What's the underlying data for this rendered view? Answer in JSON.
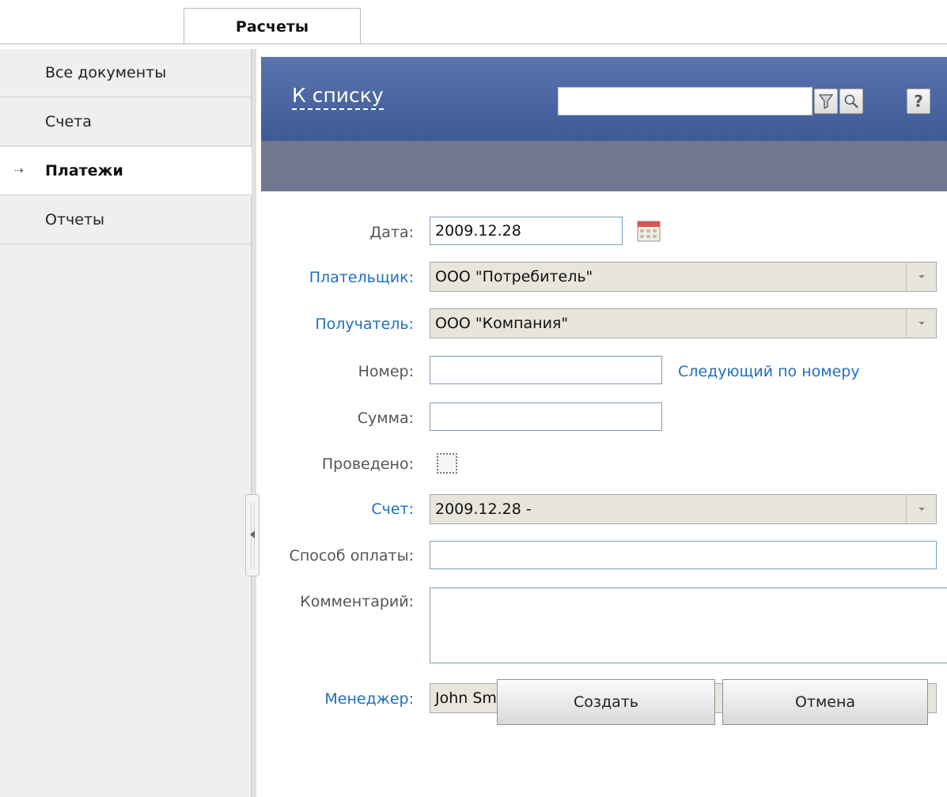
{
  "tabs": [
    {
      "label": "Расчеты"
    }
  ],
  "sidebar": {
    "items": [
      {
        "label": "Все документы"
      },
      {
        "label": "Счета"
      },
      {
        "label": "Платежи",
        "marker": "→"
      },
      {
        "label": "Отчеты"
      }
    ]
  },
  "header": {
    "back_link": "К списку",
    "search_value": "",
    "help_label": "?"
  },
  "form": {
    "date": {
      "label": "Дата:",
      "value": "2009.12.28"
    },
    "payer": {
      "label": "Плательщик:",
      "value": "ООО \"Потребитель\""
    },
    "recipient": {
      "label": "Получатель:",
      "value": "ООО \"Компания\""
    },
    "number": {
      "label": "Номер:",
      "value": "",
      "next_link": "Следующий по номеру"
    },
    "sum": {
      "label": "Сумма:",
      "value": ""
    },
    "posted": {
      "label": "Проведено:",
      "checked": false
    },
    "invoice": {
      "label": "Счет:",
      "value": "2009.12.28 -"
    },
    "payment_method": {
      "label": "Способ оплаты:",
      "value": ""
    },
    "comment": {
      "label": "Комментарий:",
      "value": ""
    },
    "manager": {
      "label": "Менеджер:",
      "value": "John Smith"
    }
  },
  "buttons": {
    "create": "Создать",
    "cancel": "Отмена"
  },
  "colors": {
    "header_blue": "#4a66a3",
    "header_gray": "#6f7890",
    "link_blue": "#1f6fbf",
    "sidebar_bg": "#efefef"
  }
}
